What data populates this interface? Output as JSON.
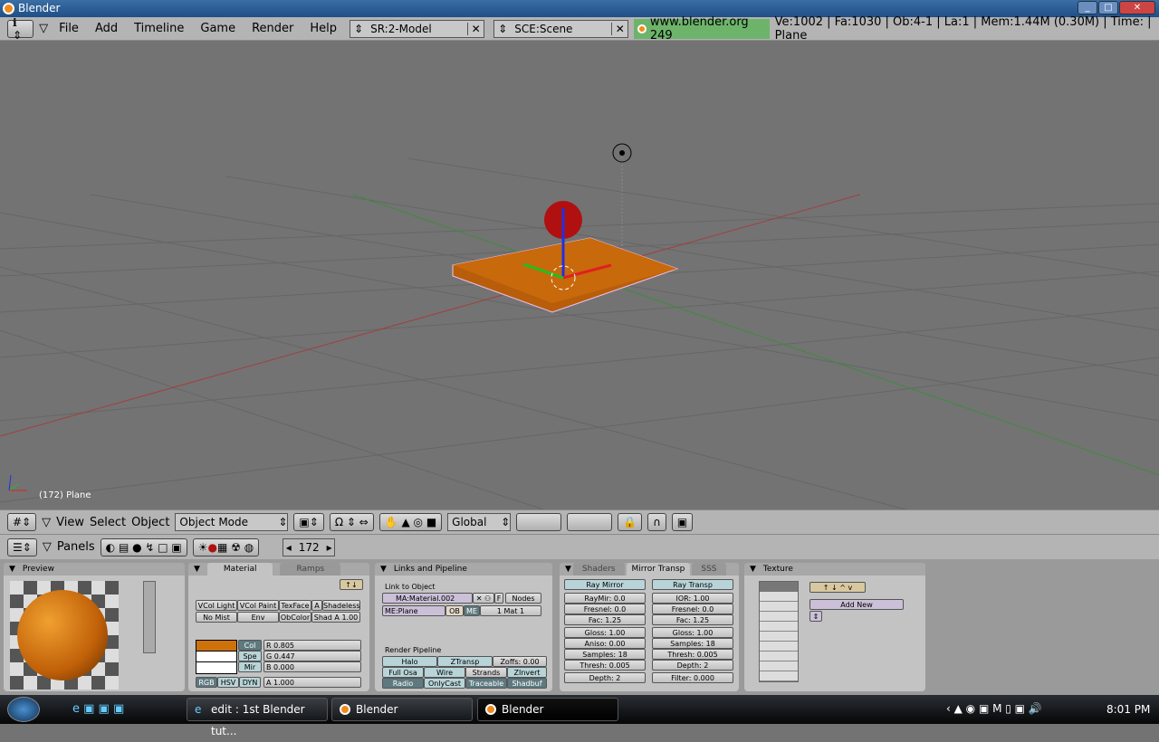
{
  "window": {
    "title": "Blender"
  },
  "menubar": {
    "menus": [
      "File",
      "Add",
      "Timeline",
      "Game",
      "Render",
      "Help"
    ],
    "screen": "SR:2-Model",
    "scene": "SCE:Scene",
    "version": "www.blender.org 249",
    "stats": "Ve:1002 | Fa:1030 | Ob:4-1 | La:1  | Mem:1.44M (0.30M)  | Time: | Plane"
  },
  "viewport": {
    "object_label": "(172) Plane",
    "colors": {
      "plane": "#c8660a",
      "sphere": "#b01010",
      "background": "#737373"
    }
  },
  "view3d_header": {
    "menus": [
      "View",
      "Select",
      "Object"
    ],
    "mode": "Object Mode",
    "orientation": "Global"
  },
  "buttons_header": {
    "panels_label": "Panels",
    "frame": "172"
  },
  "preview": {
    "title": "Preview"
  },
  "material": {
    "tabs": [
      "Material",
      "Ramps"
    ],
    "row1": [
      "VCol Light",
      "VCol Paint",
      "TexFace",
      "A",
      "Shadeless"
    ],
    "row2": [
      "No Mist",
      "Env",
      "ObColor",
      "Shad A 1.00"
    ],
    "color_buttons": [
      "Col",
      "Spe",
      "Mir"
    ],
    "sliders": [
      "R 0.805",
      "G 0.447",
      "B 0.000"
    ],
    "modes": [
      "RGB",
      "HSV",
      "DYN"
    ],
    "alpha": "A 1.000",
    "swatch_color": "#cd720a"
  },
  "links": {
    "title": "Links and Pipeline",
    "link_label": "Link to Object",
    "material": "MA:Material.002",
    "f": "F",
    "nodes": "Nodes",
    "mesh": "ME:Plane",
    "ob": "OB",
    "me": "ME",
    "mat": "1 Mat 1",
    "pipeline_label": "Render Pipeline",
    "pipeline": [
      [
        "Halo",
        "ZTransp",
        "Zoffs: 0.00"
      ],
      [
        "Full Osa",
        "Wire",
        "Strands",
        "ZInvert"
      ],
      [
        "Radio",
        "OnlyCast",
        "Traceable",
        "Shadbuf"
      ]
    ]
  },
  "shaders": {
    "tabs": [
      "Shaders",
      "Mirror Transp",
      "SSS"
    ],
    "left": [
      "Ray Mirror",
      "RayMir: 0.0",
      "Fresnel: 0.0",
      "Fac: 1.25",
      "Gloss: 1.00",
      "Aniso: 0.00",
      "Samples: 18",
      "Thresh: 0.005",
      "Depth: 2"
    ],
    "right": [
      "Ray Transp",
      "IOR: 1.00",
      "Fresnel: 0.0",
      "Fac: 1.25",
      "Gloss: 1.00",
      "Samples: 18",
      "Thresh: 0.005",
      "Depth: 2",
      "Filter: 0.000"
    ]
  },
  "texture": {
    "title": "Texture",
    "add_new": "Add New"
  },
  "taskbar": {
    "tasks": [
      "edit : 1st Blender tut...",
      "Blender",
      "Blender"
    ],
    "clock": "8:01 PM"
  }
}
